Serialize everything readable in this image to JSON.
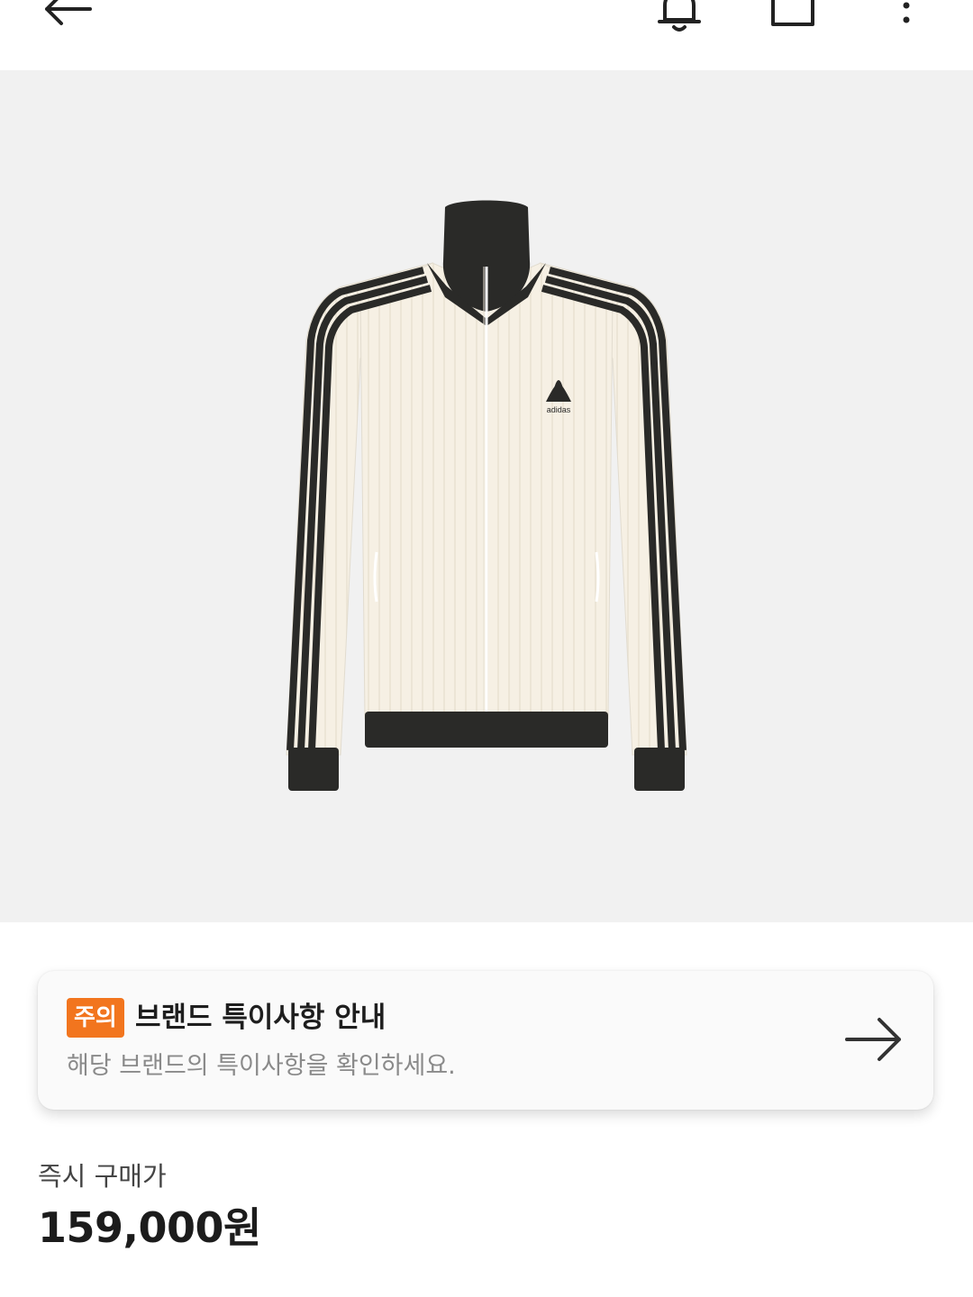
{
  "header": {
    "back_icon": "arrow-left-icon",
    "notification_icon": "bell-icon",
    "bag_icon": "shopping-bag-icon",
    "more_icon": "more-vertical-icon"
  },
  "product": {
    "image_logo_text": "adidas",
    "colors": {
      "background": "#f1f1f1",
      "body": "#f6f0e4",
      "trim": "#2a2a28"
    }
  },
  "notice": {
    "badge": "주의",
    "title": "브랜드 특이사항 안내",
    "description": "해당 브랜드의 특이사항을 확인하세요.",
    "arrow_icon": "arrow-right-icon",
    "badge_color": "#f2751e"
  },
  "price": {
    "label": "즉시 구매가",
    "value": "159,000원"
  }
}
